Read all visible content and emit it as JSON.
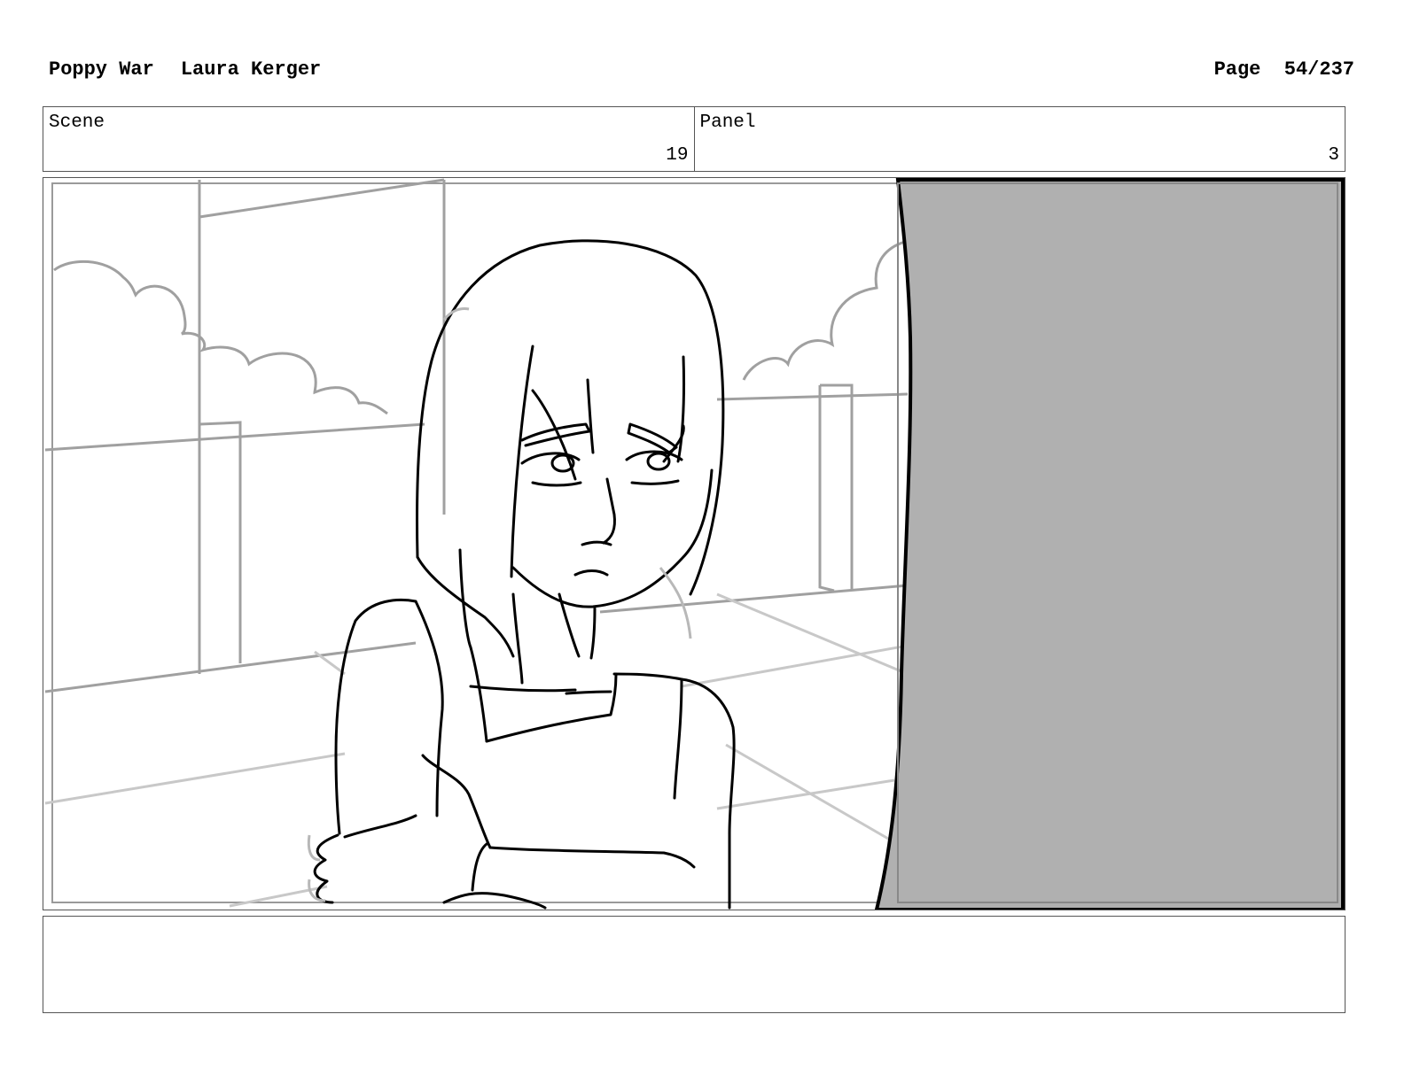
{
  "header": {
    "project": "Poppy War",
    "artist": "Laura Kerger",
    "page_label": "Page",
    "page_number": "54/237"
  },
  "info": {
    "scene_label": "Scene",
    "scene_value": "19",
    "panel_label": "Panel",
    "panel_value": "3"
  },
  "colors": {
    "foreground_shadow": "#b0b0b0",
    "sketch_line": "#000000",
    "background_line": "#a0a0a0"
  }
}
